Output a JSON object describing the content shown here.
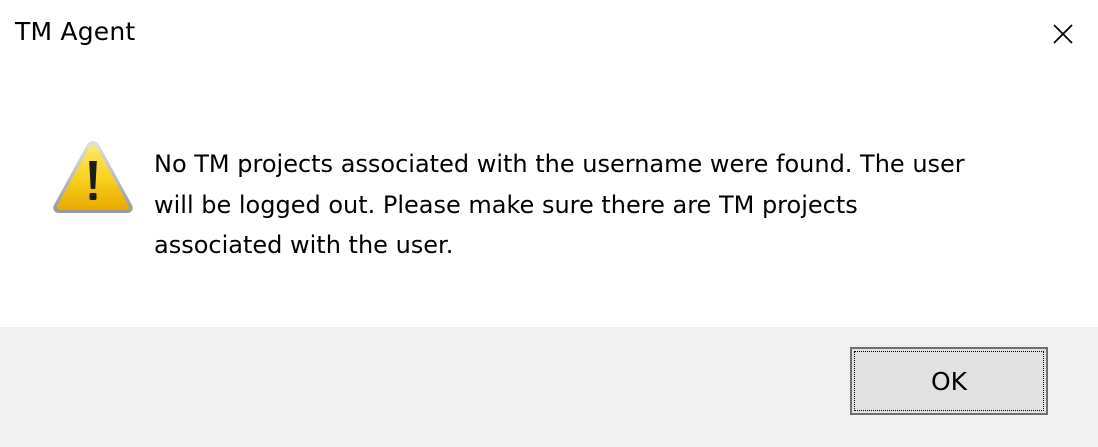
{
  "window": {
    "title": "TM Agent",
    "close_icon": "close-icon"
  },
  "dialog": {
    "icon": "warning-icon",
    "message_lines": [
      "No TM projects associated with the username were found. The user",
      "will be logged out. Please make sure there are TM projects",
      "associated with the user."
    ]
  },
  "buttons": {
    "ok_label": "OK"
  },
  "colors": {
    "footer_bg": "#f0f0f0",
    "button_bg": "#e1e1e1",
    "button_border": "#707070",
    "warning_yellow": "#f5c400"
  }
}
